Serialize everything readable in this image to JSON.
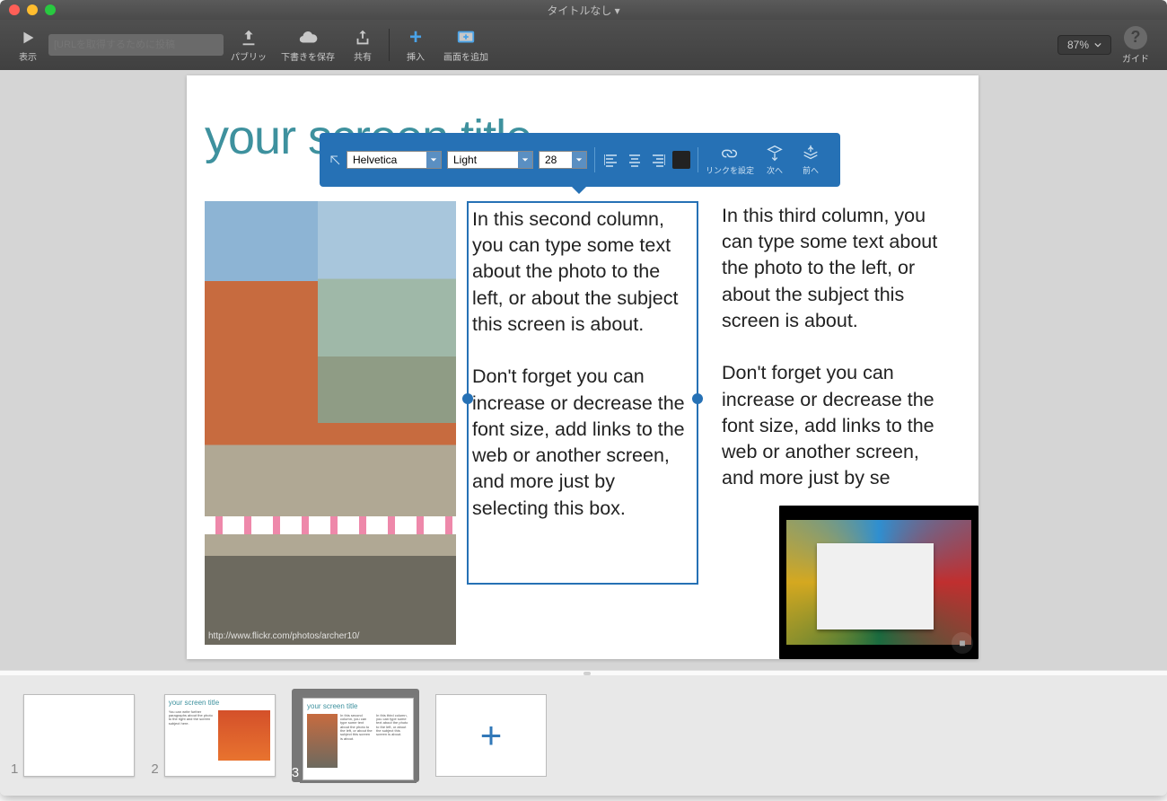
{
  "window": {
    "title": "タイトルなし ▾"
  },
  "toolbar": {
    "show": "表示",
    "url_placeholder": "[URLを取得するために投稿",
    "publish": "パブリッ",
    "savedraft": "下書きを保存",
    "share": "共有",
    "insert": "挿入",
    "addscreen": "画面を追加",
    "zoom": "87%",
    "guide": "ガイド"
  },
  "page": {
    "title": "your screen title",
    "photo_credit": "http://www.flickr.com/photos/archer10/",
    "col2": "In this second column, you can type some text about the photo to the left, or about the subject this screen is about.\n\nDon't forget you can increase or decrease the font size, add links to the web or another screen, and more just by selecting this box.",
    "col3": "In this third column, you can type some text about the photo to the left, or about the subject this screen is about.\n\nDon't forget you can increase or decrease the font size, add links to the web or another screen, and more just by se"
  },
  "float": {
    "font": "Helvetica",
    "weight": "Light",
    "size": "28",
    "link": "リンクを設定",
    "next": "次へ",
    "prev": "前へ"
  },
  "thumbs": {
    "n1": "1",
    "n2": "2",
    "n3": "3",
    "t2_title": "your screen title",
    "t3_title": "your screen title",
    "t2_body": "You can write further paragraphs about the photo to the right and the screen subject here.",
    "t3_c2": "In this second column, you can type some text about the photo to the left, or about the subject this screen is about.",
    "t3_c3": "In this third column, you can type some text about the photo to the left, or about the subject this screen is about."
  }
}
